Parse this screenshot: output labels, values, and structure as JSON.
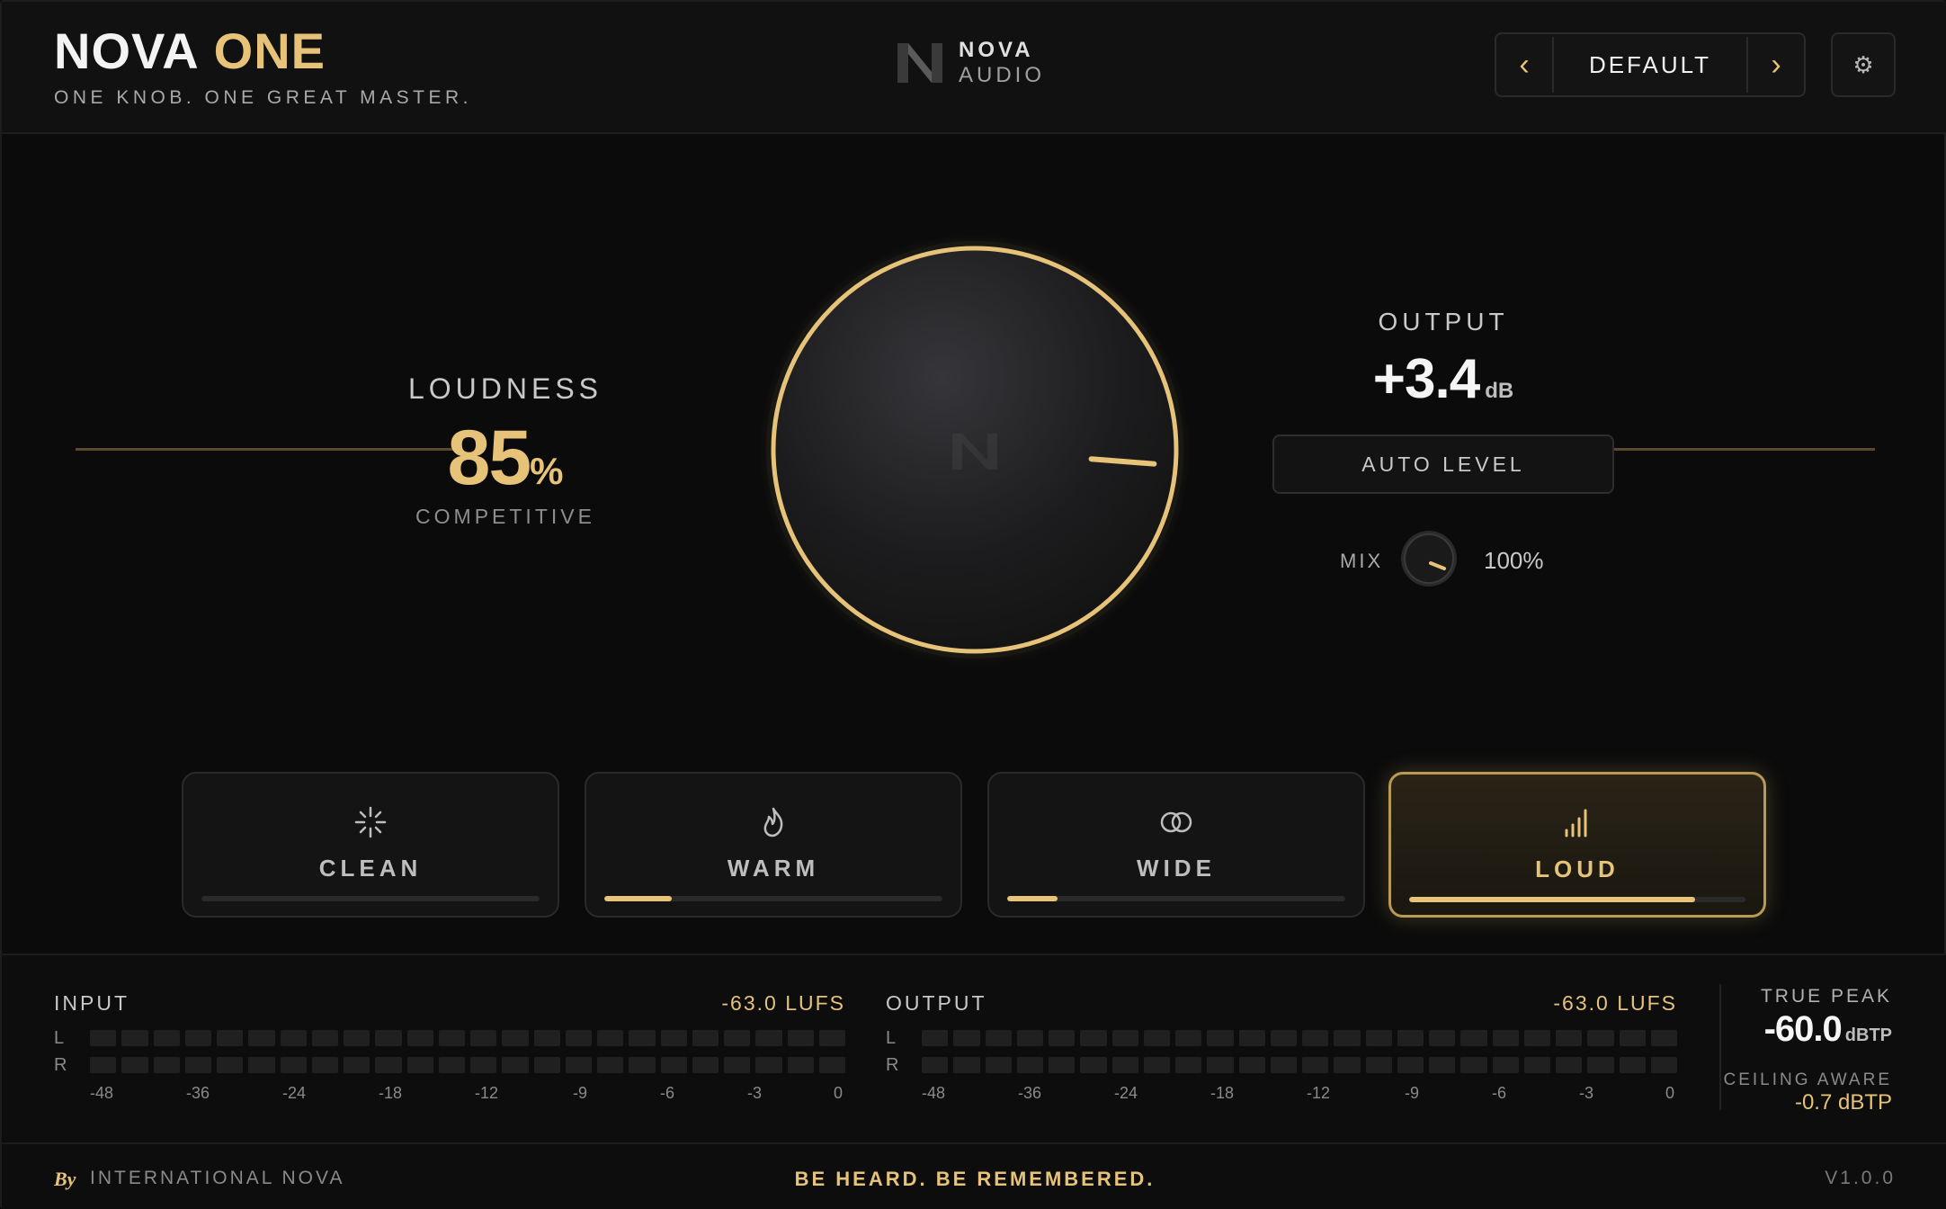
{
  "header": {
    "title_part1": "NOVA",
    "title_part2": "ONE",
    "tagline": "ONE KNOB. ONE GREAT MASTER.",
    "brand_name": "NOVA",
    "brand_sub": "AUDIO",
    "preset": {
      "prev_icon": "chevron-left-icon",
      "name": "DEFAULT",
      "next_icon": "chevron-right-icon"
    },
    "settings_icon": "gear-icon"
  },
  "loudness": {
    "label": "LOUDNESS",
    "value": "85",
    "unit": "%",
    "mode": "COMPETITIVE",
    "knob_fraction": 0.85
  },
  "output": {
    "label": "OUTPUT",
    "value": "+3.4",
    "unit": "dB",
    "auto_level_label": "AUTO LEVEL",
    "mix_label": "MIX",
    "mix_value": "100%"
  },
  "modes": [
    {
      "label": "CLEAN",
      "icon": "sparkle-icon",
      "level": 0.0,
      "active": false
    },
    {
      "label": "WARM",
      "icon": "flame-icon",
      "level": 0.2,
      "active": false
    },
    {
      "label": "WIDE",
      "icon": "stereo-circles-icon",
      "level": 0.15,
      "active": false
    },
    {
      "label": "LOUD",
      "icon": "signal-bars-icon",
      "level": 0.85,
      "active": true
    }
  ],
  "meters": {
    "input": {
      "label": "INPUT",
      "lufs": "-63.0 LUFS",
      "channels": [
        "L",
        "R"
      ]
    },
    "output": {
      "label": "OUTPUT",
      "lufs": "-63.0 LUFS",
      "channels": [
        "L",
        "R"
      ]
    },
    "scale": [
      "-48",
      "-36",
      "-24",
      "-18",
      "-12",
      "-9",
      "-6",
      "-3",
      "0"
    ],
    "true_peak_label": "TRUE PEAK",
    "true_peak_value": "-60.0",
    "true_peak_unit": "dBTP",
    "ceiling_label": "CEILING AWARE",
    "ceiling_value": "-0.7 dBTP"
  },
  "footer": {
    "by": "By",
    "company": "INTERNATIONAL NOVA",
    "slogan": "BE HEARD. BE REMEMBERED.",
    "version": "V1.0.0"
  },
  "colors": {
    "accent": "#e6c378",
    "background": "#0b0b0b",
    "panel": "#141414"
  }
}
